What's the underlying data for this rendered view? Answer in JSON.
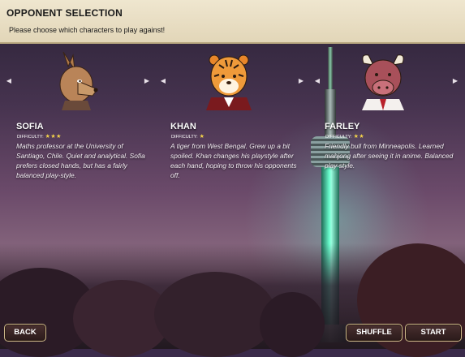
{
  "header": {
    "title": "OPPONENT SELECTION",
    "subtitle": "Please choose which characters to play against!"
  },
  "opponents": [
    {
      "name": "SOFIA",
      "difficulty_label": "DIFFICULTY:",
      "stars": "★★★",
      "difficulty": 3,
      "description": "Maths professor at the University of Santiago, Chile. Quiet and analytical. Sofia prefers closed hands, but has a fairly balanced play-style.",
      "portrait_icon": "kangaroo-portrait"
    },
    {
      "name": "KHAN",
      "difficulty_label": "DIFFICULTY:",
      "stars": "★",
      "difficulty": 1,
      "description": "A tiger from West Bengal. Grew up a bit spoiled. Khan changes his playstyle after each hand, hoping to throw his opponents off.",
      "portrait_icon": "tiger-portrait"
    },
    {
      "name": "FARLEY",
      "difficulty_label": "DIFFICULTY:",
      "stars": "★★",
      "difficulty": 2,
      "description": "Friendly bull from Minneapolis. Learned mahjong after seeing it in anime. Balanced play style.",
      "portrait_icon": "bull-portrait"
    }
  ],
  "arrows": {
    "prev": "◀",
    "next": "▶"
  },
  "buttons": {
    "back": "BACK",
    "shuffle": "SHUFFLE",
    "start": "START"
  },
  "colors": {
    "header_bg": "#e8dec4",
    "star": "#f3d24a",
    "button_bg": "#3a2424",
    "button_border": "#cdb88a",
    "tower_glow": "#6affcf"
  }
}
